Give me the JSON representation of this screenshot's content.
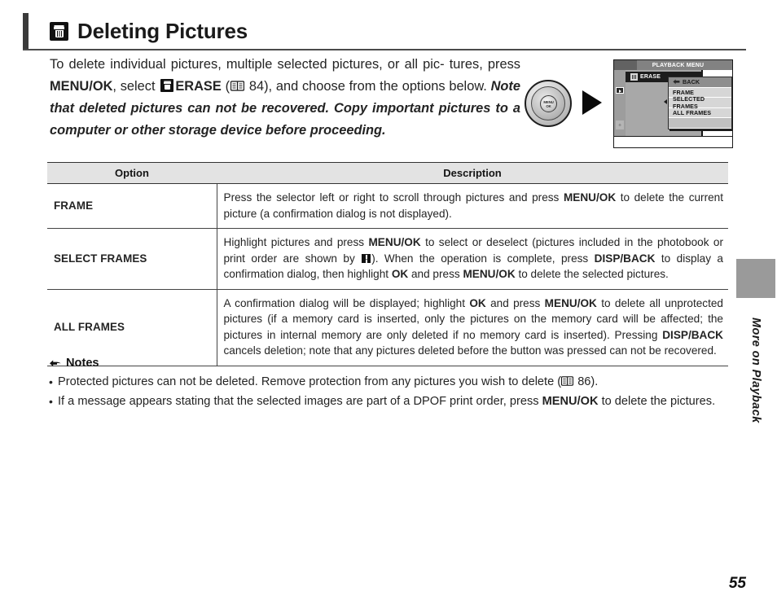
{
  "header": {
    "icon": "trash-icon",
    "title": "Deleting Pictures"
  },
  "intro": {
    "line_1": "To delete individual pictures, multiple selected pictures, or all pic-",
    "line_2_a": "tures, press ",
    "menu_ok": "MENU/OK",
    "line_2_b": ", select ",
    "erase_label": "ERASE",
    "page_ref": "84",
    "line_2_c": "), and choose from the",
    "line_3_a": "options below. ",
    "italic_note": "Note that deleted pictures can not be recovered. Copy important pictures to a computer or other storage device before proceeding.",
    "full_text": "To delete individual pictures, multiple selected pictures, or all pictures, press MENU/OK, select ERASE (84), and choose from the options below. Note that deleted pictures can not be recovered. Copy important pictures to a computer or other storage device before proceeding."
  },
  "illustration": {
    "selector_center_line1": "MENU",
    "selector_center_line2": "OK",
    "flow_arrow": "right-triangle-arrow",
    "lcd": {
      "title": "PLAYBACK MENU",
      "erase_item": "ERASE",
      "submenu": [
        {
          "label": "BACK",
          "highlighted": true,
          "has_back_arrow": true
        },
        {
          "label": "FRAME",
          "highlighted": false,
          "has_back_arrow": false
        },
        {
          "label": "SELECTED FRAMES",
          "highlighted": false,
          "has_back_arrow": false
        },
        {
          "label": "ALL FRAMES",
          "highlighted": false,
          "has_back_arrow": false
        },
        {
          "label": "",
          "highlighted": false,
          "has_back_arrow": false
        }
      ]
    }
  },
  "table": {
    "headers": {
      "option": "Option",
      "description": "Description"
    },
    "rows": [
      {
        "option": "FRAME",
        "description_parts": [
          {
            "t": "Press the selector left or right to scroll through pictures and press ",
            "b": false
          },
          {
            "t": "MENU/OK",
            "b": true
          },
          {
            "t": " to delete the current picture (a confirmation dialog is not displayed).",
            "b": false
          }
        ],
        "description": "Press the selector left or right to scroll through pictures and press MENU/OK to delete the current picture (a confirmation dialog is not displayed)."
      },
      {
        "option": "SELECT FRAMES",
        "description_parts": [
          {
            "t": "Highlight pictures and press ",
            "b": false
          },
          {
            "t": "MENU/OK",
            "b": true
          },
          {
            "t": " to select or deselect (pictures included in the photobook or print order are shown by ",
            "b": false
          },
          {
            "t": "[ICON]",
            "b": false
          },
          {
            "t": ").  When the operation is complete, press ",
            "b": false
          },
          {
            "t": "DISP/BACK",
            "b": true
          },
          {
            "t": " to display a confirmation dialog, then highlight ",
            "b": false
          },
          {
            "t": "OK",
            "b": true
          },
          {
            "t": " and press ",
            "b": false
          },
          {
            "t": "MENU/OK",
            "b": true
          },
          {
            "t": " to delete the selected pictures.",
            "b": false
          }
        ],
        "description": "Highlight pictures and press MENU/OK to select or deselect (pictures included in the photobook or print order are shown by ). When the operation is complete, press DISP/BACK to display a confirmation dialog, then highlight OK and press MENU/OK to delete the selected pictures."
      },
      {
        "option": "ALL FRAMES",
        "description_parts": [
          {
            "t": "A confirmation dialog will be displayed; highlight ",
            "b": false
          },
          {
            "t": "OK",
            "b": true
          },
          {
            "t": " and press ",
            "b": false
          },
          {
            "t": "MENU/OK",
            "b": true
          },
          {
            "t": " to delete all unprotected pictures (if a memory card is inserted, only the pictures on the memory card will be affected; the pictures in internal memory are only deleted if no memory card is inserted).  Pressing ",
            "b": false
          },
          {
            "t": "DISP/BACK",
            "b": true
          },
          {
            "t": " cancels deletion; note that any pictures deleted before the button was pressed can not be recovered.",
            "b": false
          }
        ],
        "description": "A confirmation dialog will be displayed; highlight OK and press MENU/OK to delete all unprotected pictures (if a memory card is inserted, only the pictures on the memory card will be affected; the pictures in internal memory are only deleted if no memory card is inserted). Pressing DISP/BACK cancels deletion; note that any pictures deleted before the button was pressed can not be recovered."
      }
    ]
  },
  "notes": {
    "heading": "Notes",
    "heading_icon": "pointing-hand-icon",
    "items": [
      {
        "bullet": "•",
        "parts": [
          {
            "t": "Protected pictures can not be deleted.  Remove protection from any pictures you wish to delete (",
            "b": false
          },
          {
            "t": "[BOOK]",
            "b": false
          },
          {
            "t": " 86).",
            "b": false
          }
        ],
        "text": "Protected pictures can not be deleted.  Remove protection from any pictures you wish to delete (86).",
        "page_ref": "86"
      },
      {
        "bullet": "•",
        "parts": [
          {
            "t": "If a message appears stating that the selected images are part of a DPOF print order, press ",
            "b": false
          },
          {
            "t": "MENU/OK",
            "b": true
          },
          {
            "t": " to delete the pictures.",
            "b": false
          }
        ],
        "text": "If a message appears stating that the selected images are part of a DPOF print order, press MENU/OK to delete the pictures."
      }
    ]
  },
  "side_tab": {
    "label": "More on Playback"
  },
  "footer": {
    "page_number": "55"
  },
  "colors": {
    "table_header_bg": "#e3e3e3",
    "side_tab_gray": "#9a9a9a",
    "lcd_title_bg": "#828282",
    "text": "#242424"
  }
}
